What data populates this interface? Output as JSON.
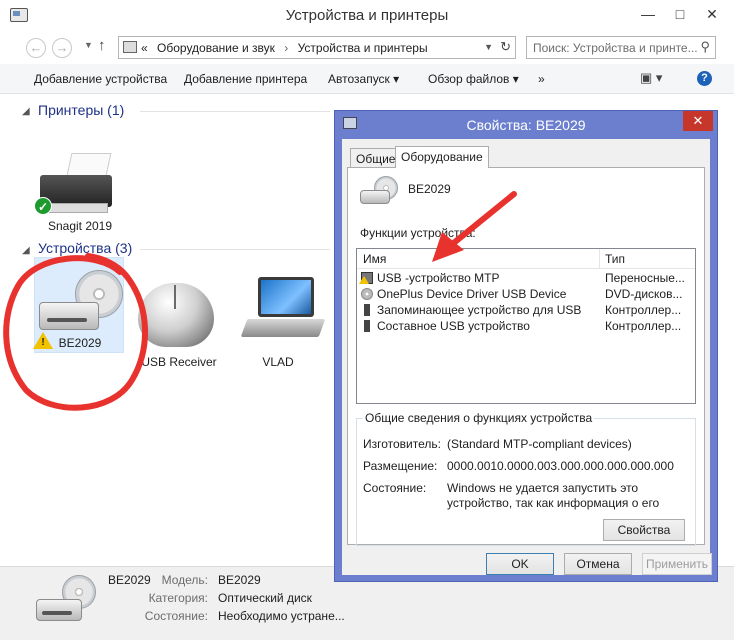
{
  "window": {
    "title": "Устройства и принтеры",
    "controls": {
      "minimize": "—",
      "maximize": "□",
      "close": "✕"
    }
  },
  "nav": {
    "back": "←",
    "forward": "→",
    "dropdown": "▼",
    "up": "↑"
  },
  "address": {
    "prefix": "«",
    "crumb1": "Оборудование и звук",
    "separator": "›",
    "crumb2": "Устройства и принтеры",
    "dropdown": "▼",
    "refresh": "↻"
  },
  "search": {
    "placeholder": "Поиск: Устройства и принте...",
    "icon": "⚲"
  },
  "toolbar": {
    "add_device": "Добавление устройства",
    "add_printer": "Добавление принтера",
    "autoplay": "Автозапуск ▾",
    "browse_files": "Обзор файлов ▾",
    "more": "»",
    "view": "▣ ▾",
    "help": "?"
  },
  "printers": {
    "header": "Принтеры (1)",
    "items": [
      {
        "label": "Snagit 2019"
      }
    ]
  },
  "devices": {
    "header": "Устройства (3)",
    "items": [
      {
        "label": "BE2029"
      },
      {
        "label": "USB Receiver"
      },
      {
        "label": "VLAD"
      }
    ]
  },
  "status_bar": {
    "device_name": "BE2029",
    "model_label": "Модель:",
    "model_value": "BE2029",
    "category_label": "Категория:",
    "category_value": "Оптический диск",
    "state_label": "Состояние:",
    "state_value": "Необходимо устране..."
  },
  "dialog": {
    "title": "Свойства: BE2029",
    "close": "✕",
    "tabs": [
      {
        "label": "Общие"
      },
      {
        "label": "Оборудование"
      }
    ],
    "device_name": "BE2029",
    "functions_label": "Функции устройства:",
    "columns": {
      "name": "Имя",
      "type": "Тип"
    },
    "rows": [
      {
        "name": "USB -устройство MTP",
        "type": "Переносные..."
      },
      {
        "name": "OnePlus Device Driver USB Device",
        "type": "DVD-дисков..."
      },
      {
        "name": "Запоминающее устройство для USB",
        "type": "Контроллер..."
      },
      {
        "name": "Составное USB устройство",
        "type": "Контроллер..."
      }
    ],
    "summary_legend": "Общие сведения о функциях устройства",
    "manufacturer_label": "Изготовитель:",
    "manufacturer_value": "(Standard MTP-compliant devices)",
    "location_label": "Размещение:",
    "location_value": "0000.0010.0000.003.000.000.000.000.000",
    "status_label": "Состояние:",
    "status_value": "Windows не удается запустить это устройство, так как информация о его конфигурации в реестре",
    "properties_button": "Свойства",
    "ok_button": "OK",
    "cancel_button": "Отмена",
    "apply_button": "Применить"
  },
  "colors": {
    "group_header": "#1e3287",
    "dialog_frame": "#6b7fce",
    "close_button": "#c7362b",
    "annotation": "#e8322e",
    "selection": "#dcecfc"
  }
}
